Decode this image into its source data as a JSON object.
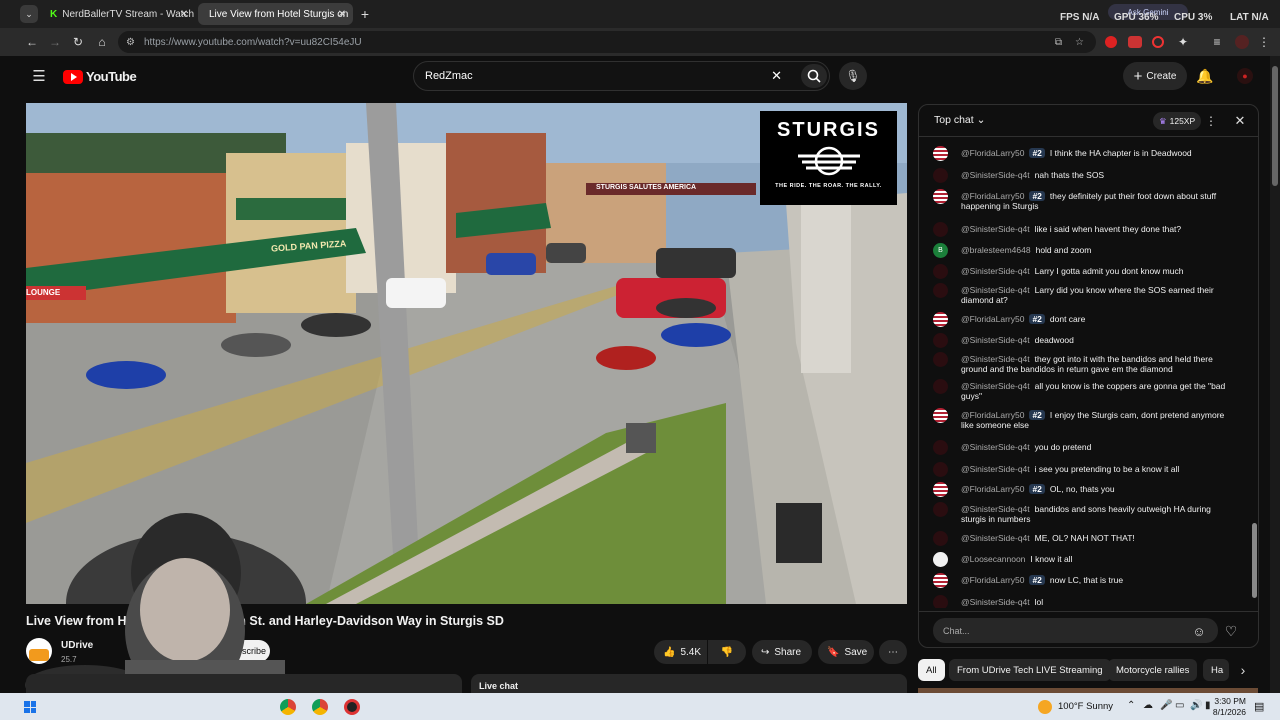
{
  "browser": {
    "tabs": [
      {
        "title": "NerdBallerTV Stream - Watch Li",
        "favicon": "k-icon",
        "active": false
      },
      {
        "title": "Live View from Hotel Sturgis on",
        "favicon": "youtube-icon",
        "active": true
      }
    ],
    "new_tab": "+",
    "url": "https://www.youtube.com/watch?v=uu82CI54eJU"
  },
  "perf": {
    "fps_label": "FPS",
    "fps": "N/A",
    "gpu_label": "GPU",
    "gpu": "36%",
    "cpu_label": "CPU",
    "cpu": "3%",
    "lat_label": "LAT",
    "lat": "N/A",
    "gemini": "Ask Gemini"
  },
  "youtube": {
    "logo": "YouTube",
    "search_value": "RedZmac",
    "create": "Create"
  },
  "video": {
    "overlay_brand": "STURGIS",
    "overlay_tag": "THE RIDE. THE ROAR. THE RALLY.",
    "sign_gold": "GOLD PAN PIZZA",
    "sign_lounge": "LOUNGE",
    "sign_banner": "STURGIS SALUTES AMERICA",
    "title": "Live View from Hotel Sturgis on Main St. and Harley-Davidson Way in Sturgis SD",
    "channel": "UDrive",
    "subs": "25.7",
    "subscribe": "Subscribe",
    "likes": "5.4K",
    "share": "Share",
    "save": "Save",
    "live_chat": "Live chat"
  },
  "chat": {
    "header": "Top chat",
    "xp": "125XP",
    "placeholder": "Chat...",
    "messages": [
      {
        "author": "@FloridaLarry50",
        "badge": "#2",
        "text": "I think the HA chapter is in Deadwood",
        "avatar": "flag"
      },
      {
        "author": "@SinisterSide-q4t",
        "badge": "",
        "text": "nah thats the SOS",
        "avatar": "dark"
      },
      {
        "author": "@FloridaLarry50",
        "badge": "#2",
        "text": "they definitely put their foot down about stuff happening in Sturgis",
        "avatar": "flag"
      },
      {
        "author": "@SinisterSide-q4t",
        "badge": "",
        "text": "like i said when havent they done that?",
        "avatar": "dark"
      },
      {
        "author": "@bralesteem4648",
        "badge": "",
        "text": "hold and zoom",
        "avatar": "green",
        "initial": "B"
      },
      {
        "author": "@SinisterSide-q4t",
        "badge": "",
        "text": "Larry I gotta admit you dont know much",
        "avatar": "dark"
      },
      {
        "author": "@SinisterSide-q4t",
        "badge": "",
        "text": "Larry did you know where the SOS earned their diamond at?",
        "avatar": "dark"
      },
      {
        "author": "@FloridaLarry50",
        "badge": "#2",
        "text": "dont care",
        "avatar": "flag"
      },
      {
        "author": "@SinisterSide-q4t",
        "badge": "",
        "text": "deadwood",
        "avatar": "dark"
      },
      {
        "author": "@SinisterSide-q4t",
        "badge": "",
        "text": "they got into it with the bandidos and held there ground and the bandidos in return gave em the diamond",
        "avatar": "dark"
      },
      {
        "author": "@SinisterSide-q4t",
        "badge": "",
        "text": "all you know is the coppers are gonna get the \"bad guys\"",
        "avatar": "dark"
      },
      {
        "author": "@FloridaLarry50",
        "badge": "#2",
        "text": "I enjoy the Sturgis cam, dont pretend anymore like someone else",
        "avatar": "flag"
      },
      {
        "author": "@SinisterSide-q4t",
        "badge": "",
        "text": "you do pretend",
        "avatar": "dark"
      },
      {
        "author": "@SinisterSide-q4t",
        "badge": "",
        "text": "i see you pretending to be a know it all",
        "avatar": "dark"
      },
      {
        "author": "@FloridaLarry50",
        "badge": "#2",
        "text": "OL, no, thats you",
        "avatar": "flag"
      },
      {
        "author": "@SinisterSide-q4t",
        "badge": "",
        "text": "bandidos and sons heavily outweigh HA during sturgis in numbers",
        "avatar": "dark"
      },
      {
        "author": "@SinisterSide-q4t",
        "badge": "",
        "text": "ME, OL? NAH NOT THAT!",
        "avatar": "dark"
      },
      {
        "author": "@Loosecannoon",
        "badge": "",
        "text": "I know it all",
        "avatar": "white"
      },
      {
        "author": "@FloridaLarry50",
        "badge": "#2",
        "text": "now LC, that is true",
        "avatar": "flag"
      },
      {
        "author": "@SinisterSide-q4t",
        "badge": "",
        "text": "lol",
        "avatar": "dark"
      }
    ]
  },
  "chips": [
    "All",
    "From UDrive Tech LIVE Streaming",
    "Motorcycle rallies",
    "Ha"
  ],
  "taskbar": {
    "weather": "100°F  Sunny",
    "time": "3:30 PM",
    "date": "8/1/2026"
  }
}
